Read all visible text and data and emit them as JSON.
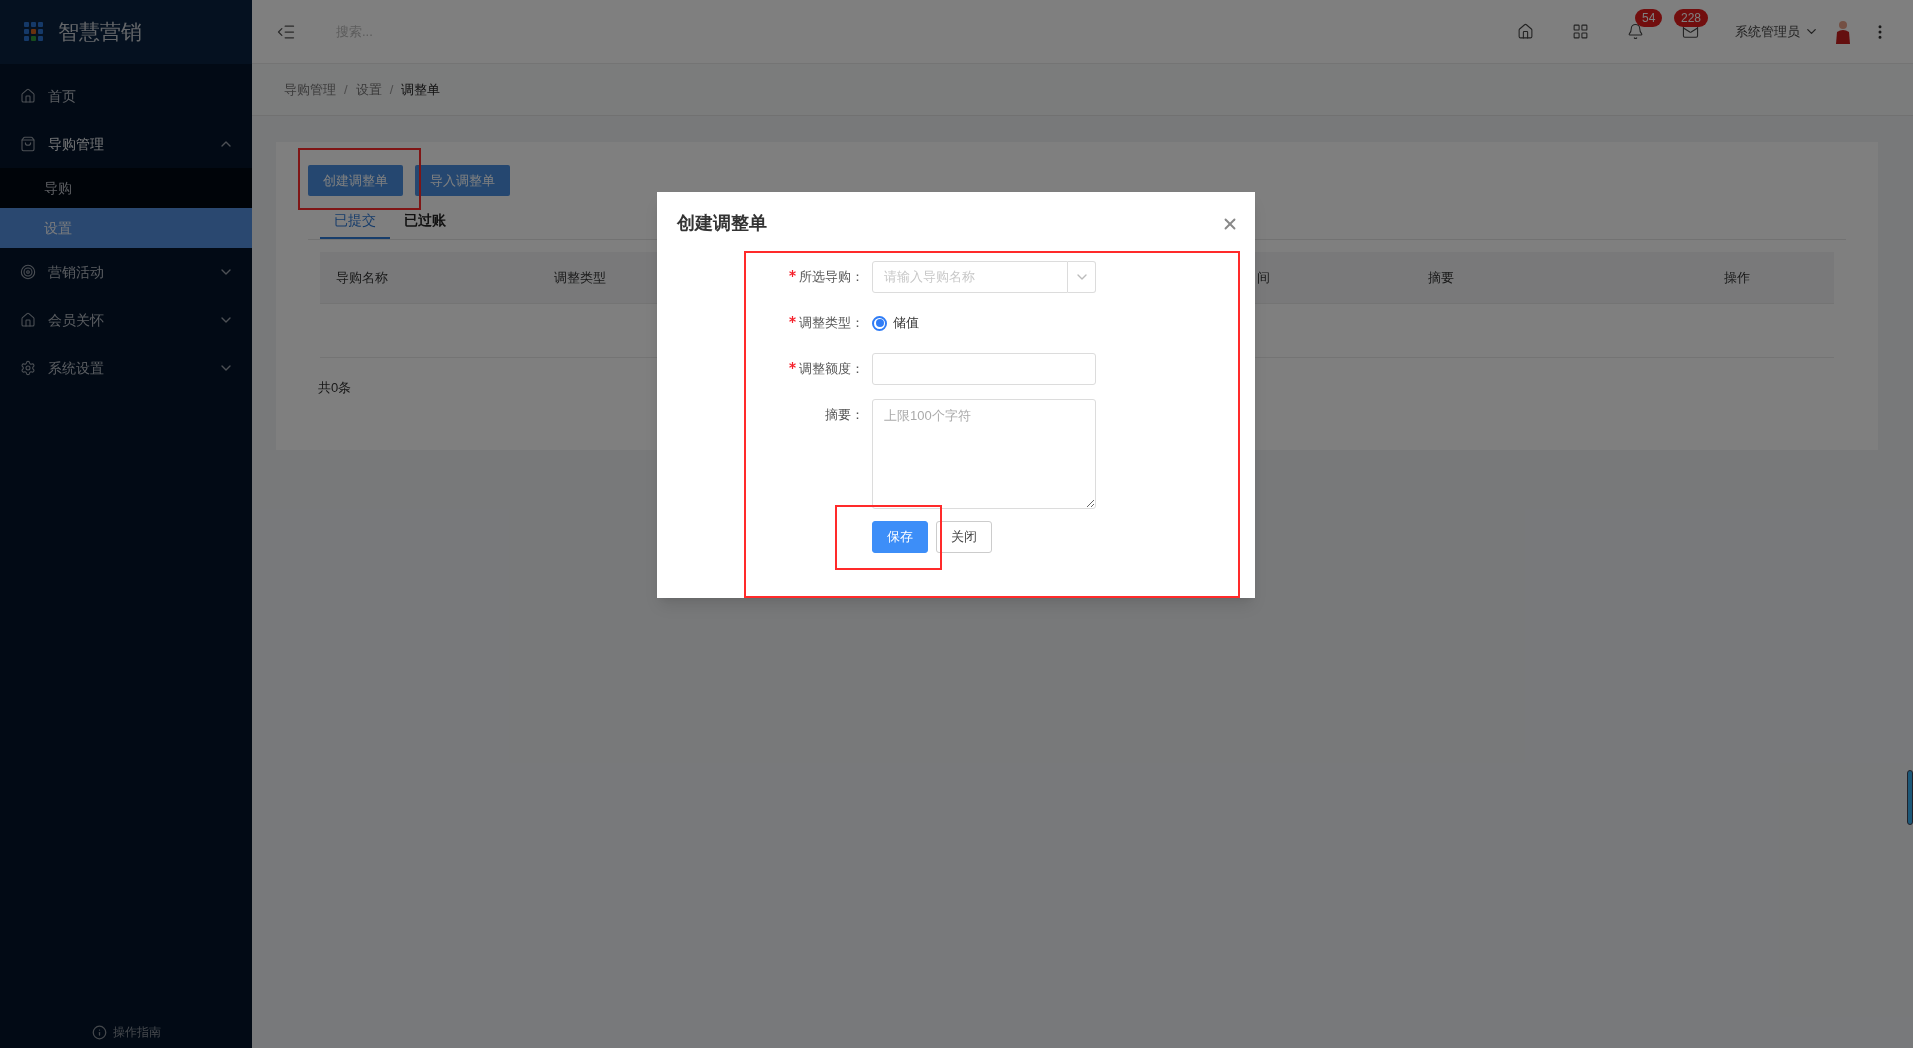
{
  "sidebar": {
    "logo_text": "智慧营销",
    "items": [
      {
        "label": "首页"
      },
      {
        "label": "导购管理",
        "expanded": true,
        "children": [
          {
            "label": "导购",
            "selected": false
          },
          {
            "label": "设置",
            "selected": true
          }
        ]
      },
      {
        "label": "营销活动",
        "expanded": false
      },
      {
        "label": "会员关怀",
        "expanded": false
      },
      {
        "label": "系统设置",
        "expanded": false
      }
    ],
    "footer": "操作指南"
  },
  "header": {
    "search": {
      "placeholder": "搜索..."
    },
    "notifications_badge": "54",
    "messages_badge": "228",
    "user": "系统管理员"
  },
  "breadcrumb": [
    {
      "label": "导购管理",
      "current": false
    },
    {
      "separator": "/",
      "label": "设置",
      "current": false
    },
    {
      "separator": "/",
      "label": "调整单",
      "current": true
    }
  ],
  "buttons": [
    "创建调整单",
    "导入调整单"
  ],
  "tabs": [
    {
      "label": "已提交",
      "selected": true
    },
    {
      "label": "已过账",
      "selected": false
    }
  ],
  "table": {
    "columns": [
      "导购名称",
      "调整类型",
      "间",
      "摘要",
      "操作"
    ],
    "total": "共0条"
  },
  "dialog": {
    "title": "创建调整单",
    "fields": [
      {
        "kind": "select",
        "label": "所选导购：",
        "required": true,
        "placeholder": "请输入导购名称"
      },
      {
        "kind": "radio",
        "label": "调整类型：",
        "required": true,
        "options": [
          {
            "label": "储值",
            "selected": true
          }
        ]
      },
      {
        "kind": "input",
        "label": "调整额度：",
        "required": true
      },
      {
        "kind": "textarea",
        "label": "摘要：",
        "required": false,
        "placeholder": "上限100个字符"
      }
    ],
    "buttons": [
      {
        "label": "保存",
        "primary": true
      },
      {
        "label": "关闭",
        "primary": false
      }
    ]
  }
}
